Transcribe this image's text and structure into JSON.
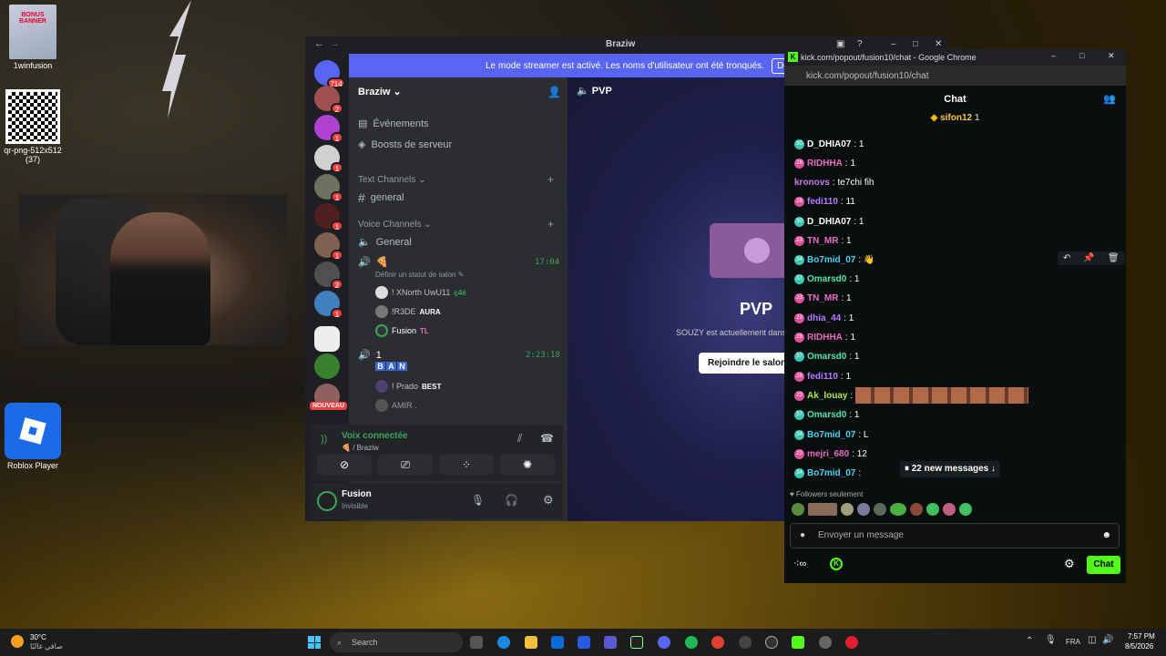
{
  "desktop": {
    "icons": [
      {
        "label": "1winfusion",
        "banner": "BONUS BANNER"
      },
      {
        "label": "qr-png-512x512\n(37)"
      },
      {
        "label": "Roblox Player"
      }
    ]
  },
  "discord": {
    "window_title": "Braziw",
    "banner_text": "Le mode streamer est activé. Les noms d'utilisateur ont été tronqués.",
    "banner_button": "Désactiv",
    "server_name": "Braziw",
    "server_badges": [
      "714",
      "2",
      "1",
      "1",
      "1",
      "1",
      "1",
      "2",
      "1",
      "NOUVEAU"
    ],
    "events": "Événements",
    "boosts": "Boosts de serveur",
    "text_channels": "Text Channels",
    "general": "general",
    "voice_channels": "Voice Channels",
    "voice_general": "General",
    "channel2_time": "17:04",
    "status_prompt": "Définir un statut de salon",
    "voice_users1": [
      {
        "name": "! XNorth UwU11",
        "tag": "ç4ë"
      },
      {
        "name": "!R3DE",
        "tag": "AURA"
      },
      {
        "name": "Fusion",
        "tag": "TL"
      }
    ],
    "channel3_name": "1",
    "channel3_time": "2:23:18",
    "ban_letters": [
      "B",
      "A",
      "N"
    ],
    "voice_users2": [
      {
        "name": "! Prado",
        "tag": "BEST"
      },
      {
        "name": "AMIR ."
      }
    ],
    "voice_connected": "Voix connectée",
    "voice_sub": "/ Braziw",
    "user_name": "Fusion",
    "user_status": "Invisible",
    "main_channel": "PVP",
    "main_title": "PVP",
    "main_text": "SOUZY est actuellement dans",
    "join_button": "Rejoindre le salon"
  },
  "chrome": {
    "title": "kick.com/popout/fusion10/chat - Google Chrome",
    "url": "kick.com/popout/fusion10/chat",
    "chat_title": "Chat",
    "pinned_user": "sifon12",
    "pinned_count": "1",
    "messages": [
      {
        "badge": "30",
        "c": "bg",
        "name": "D_DHIA07",
        "color": "#fff",
        "text": ": 1"
      },
      {
        "badge": "28",
        "c": "bp",
        "name": "RIDHHA",
        "color": "#e86cc0",
        "text": ": 1"
      },
      {
        "badge": "",
        "c": "",
        "name": "kronovs",
        "color": "#c57ae8",
        "text": ": te7chi fih"
      },
      {
        "badge": "28",
        "c": "bp",
        "name": "fedi110",
        "color": "#b57aff",
        "text": ": 11"
      },
      {
        "badge": "30",
        "c": "bg",
        "name": "D_DHIA07",
        "color": "#fff",
        "text": ": 1"
      },
      {
        "badge": "23",
        "c": "bp",
        "name": "TN_MR",
        "color": "#e86cc0",
        "text": ": 1"
      },
      {
        "badge": "34",
        "c": "bg",
        "name": "Bo7mid_07",
        "color": "#4ad1f0",
        "text": ": 👋"
      },
      {
        "badge": "37",
        "c": "bg",
        "name": "Omarsd0",
        "color": "#4ae8b0",
        "text": ": 1"
      },
      {
        "badge": "23",
        "c": "bp",
        "name": "TN_MR",
        "color": "#e86cc0",
        "text": ": 1"
      },
      {
        "badge": "23",
        "c": "bp",
        "name": "dhia_44",
        "color": "#b57aff",
        "text": ": 1"
      },
      {
        "badge": "28",
        "c": "bp",
        "name": "RIDHHA",
        "color": "#e86cc0",
        "text": ": 1"
      },
      {
        "badge": "37",
        "c": "bg",
        "name": "Omarsd0",
        "color": "#4ae8b0",
        "text": ": 1"
      },
      {
        "badge": "28",
        "c": "bp",
        "name": "fedi110",
        "color": "#b57aff",
        "text": ": 1"
      },
      {
        "badge": "23",
        "c": "bp",
        "name": "Ak_louay",
        "color": "#a8e848",
        "text": ":"
      },
      {
        "badge": "37",
        "c": "bg",
        "name": "Omarsd0",
        "color": "#4ae8b0",
        "text": ": 1"
      },
      {
        "badge": "34",
        "c": "bg",
        "name": "Bo7mid_07",
        "color": "#4ad1f0",
        "text": ": L"
      },
      {
        "badge": "23",
        "c": "bp",
        "name": "mejri_680",
        "color": "#e86cc0",
        "text": ": 12"
      },
      {
        "badge": "34",
        "c": "bg",
        "name": "Bo7mid_07",
        "color": "#4ad1f0",
        "text": ":"
      }
    ],
    "new_messages": "22 new messages",
    "followers_only": "Followers seulement",
    "input_placeholder": "Envoyer un message",
    "chat_button": "Chat"
  },
  "taskbar": {
    "weather_temp": "30°C",
    "weather_desc": "صافي غالبًا",
    "search": "Search",
    "lang": "FRA",
    "time": "7:57 PM",
    "date": "8/5/2026"
  }
}
